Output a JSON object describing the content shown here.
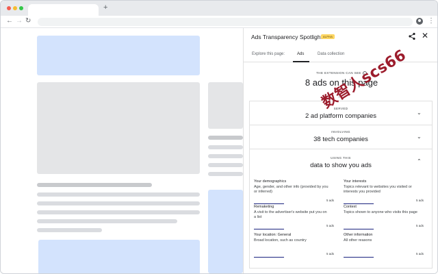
{
  "browser": {
    "new_tab_symbol": "+",
    "icons": [
      "back-icon",
      "forward-icon",
      "reload-icon",
      "account-icon",
      "kebab-menu-icon"
    ]
  },
  "panel": {
    "title": "Ads Transparency Spotlight",
    "badge": "ALPHA",
    "tabs": [
      {
        "label": "Explore this page:"
      },
      {
        "label": "Ads",
        "active": true
      },
      {
        "label": "Data collection"
      }
    ],
    "can_see_label": "THE EXTENSION CAN SEE",
    "ads_count": "8 ads on this page",
    "served_label": "SERVED",
    "served_value": "2 ad platform companies",
    "involving_label": "INVOLVING",
    "involving_value": "38 tech companies",
    "using_label": "USING THIS",
    "using_value": "data to show you ads",
    "categories": [
      {
        "title": "Your demographics",
        "desc": "Age, gender, and other info (provided by you or inferred)",
        "count": "5 ads",
        "share": 0.6
      },
      {
        "title": "Your interests",
        "desc": "Topics relevant to websites you visited or interests you provided",
        "count": "5 ads",
        "share": 0.6
      },
      {
        "title": "Remaketing",
        "desc": "A visit to the advertiser's website put you on a list",
        "count": "5 ads",
        "share": 0.6
      },
      {
        "title": "Context",
        "desc": "Topics shown to anyone who visits this page",
        "count": "5 ads",
        "share": 0.6
      },
      {
        "title": "Your location: General",
        "desc": "Broad location, such as country",
        "count": "5 ads",
        "share": 0.6
      },
      {
        "title": "Other information",
        "desc": "All other reasons",
        "count": "5 ads",
        "share": 0.6
      }
    ]
  },
  "watermark": "数智人scs66",
  "colors": {
    "accent_bar": "#1a237e",
    "placeholder_blue": "#d3e3fd",
    "badge": "#fdd663"
  }
}
